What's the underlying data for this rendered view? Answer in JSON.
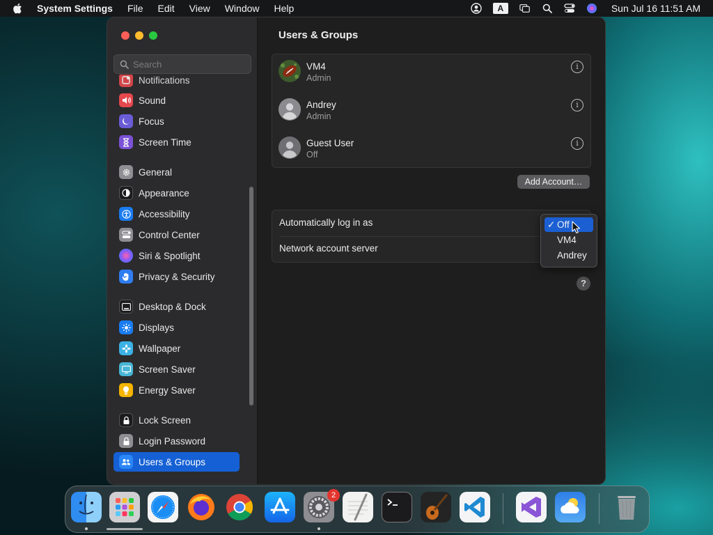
{
  "menubar": {
    "app_name": "System Settings",
    "items": [
      "File",
      "Edit",
      "View",
      "Window",
      "Help"
    ],
    "status_icons": [
      "user-account-icon",
      "input-source-icon",
      "screen-mirroring-icon",
      "spotlight-icon",
      "control-center-icon",
      "siri-icon"
    ],
    "input_source": "A",
    "clock": "Sun Jul 16  11:51 AM"
  },
  "sidebar": {
    "search_placeholder": "Search",
    "items": [
      {
        "label": "Notifications",
        "icon": "notifications-icon",
        "color": "#e5484d"
      },
      {
        "label": "Sound",
        "icon": "sound-icon",
        "color": "#e5484d"
      },
      {
        "label": "Focus",
        "icon": "focus-moon-icon",
        "color": "#6a5cd6"
      },
      {
        "label": "Screen Time",
        "icon": "hourglass-icon",
        "color": "#7b52d6"
      },
      {
        "label": "General",
        "icon": "gear-icon",
        "color": "#8e8e93"
      },
      {
        "label": "Appearance",
        "icon": "appearance-icon",
        "color": "#1c1c1e"
      },
      {
        "label": "Accessibility",
        "icon": "accessibility-icon",
        "color": "#1a7cf0"
      },
      {
        "label": "Control Center",
        "icon": "control-center-icon",
        "color": "#8e8e93"
      },
      {
        "label": "Siri & Spotlight",
        "icon": "siri-icon",
        "color": "#b1429c"
      },
      {
        "label": "Privacy & Security",
        "icon": "hand-icon",
        "color": "#2f7df1"
      },
      {
        "label": "Desktop & Dock",
        "icon": "desktop-dock-icon",
        "color": "#1c1c1e"
      },
      {
        "label": "Displays",
        "icon": "displays-sun-icon",
        "color": "#1a7cf0"
      },
      {
        "label": "Wallpaper",
        "icon": "wallpaper-flower-icon",
        "color": "#3cb1e6"
      },
      {
        "label": "Screen Saver",
        "icon": "screen-saver-icon",
        "color": "#48b6d6"
      },
      {
        "label": "Energy Saver",
        "icon": "lightbulb-icon",
        "color": "#f5b400"
      },
      {
        "label": "Lock Screen",
        "icon": "lock-icon",
        "color": "#1c1c1e"
      },
      {
        "label": "Login Password",
        "icon": "login-lock-icon",
        "color": "#8e8e93"
      },
      {
        "label": "Users & Groups",
        "icon": "users-icon",
        "color": "#1a7cf0"
      }
    ],
    "selected": "Users & Groups"
  },
  "main": {
    "title": "Users & Groups",
    "users": [
      {
        "name": "VM4",
        "role": "Admin",
        "avatar": "football-avatar-icon"
      },
      {
        "name": "Andrey",
        "role": "Admin",
        "avatar": "default-user-avatar-icon"
      },
      {
        "name": "Guest User",
        "role": "Off",
        "avatar": "default-user-avatar-icon"
      }
    ],
    "add_account_label": "Add Account…",
    "settings_rows": [
      "Automatically log in as",
      "Network account server"
    ],
    "help_label": "?",
    "info_glyph": "i"
  },
  "autologin_menu": {
    "options": [
      "Off",
      "VM4",
      "Andrey"
    ],
    "selected": "Off",
    "check_glyph": "✓"
  },
  "dock": {
    "apps": [
      "finder-icon",
      "launchpad-icon",
      "safari-icon",
      "firefox-icon",
      "chrome-icon",
      "app-store-icon",
      "system-settings-icon",
      "textedit-icon",
      "terminal-icon",
      "garageband-icon",
      "vscode-icon",
      "visual-studio-icon",
      "weather-icon",
      "trash-icon"
    ],
    "system_settings_badge": "2"
  }
}
